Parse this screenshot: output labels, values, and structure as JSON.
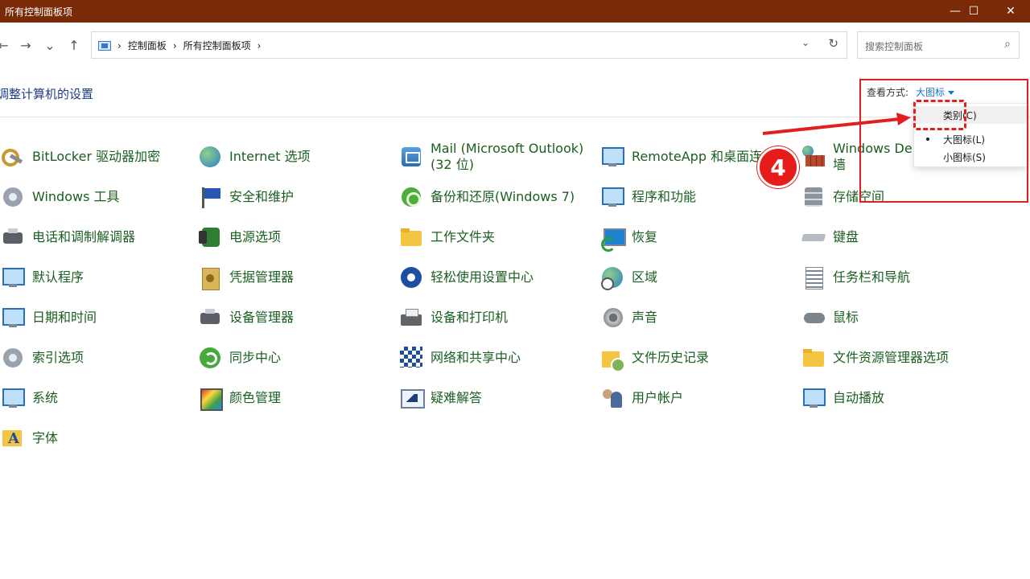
{
  "window": {
    "title": "所有控制面板项",
    "minimize": "—",
    "maximize": "☐",
    "close": "✕"
  },
  "nav": {
    "back": "←",
    "forward": "→",
    "recent": "⌄",
    "up": "↑",
    "breadcrumb": [
      "控制面板",
      "所有控制面板项"
    ],
    "sep": "›",
    "dropdown": "⌄",
    "refresh": "↻",
    "search_placeholder": "搜索控制面板",
    "search_icon": "⌕"
  },
  "header": {
    "title": "调整计算机的设置",
    "view_by_label": "查看方式:",
    "view_by_value": "大图标"
  },
  "items": [
    {
      "lines": [
        "BitLocker 驱动器加密"
      ],
      "icon": "key"
    },
    {
      "lines": [
        "Internet 选项"
      ],
      "icon": "globe"
    },
    {
      "lines": [
        "Mail (Microsoft Outlook)",
        "(32 位)"
      ],
      "icon": "mail"
    },
    {
      "lines": [
        "RemoteApp 和桌面连"
      ],
      "icon": "blue"
    },
    {
      "lines": [
        "Windows De",
        "墙"
      ],
      "icon": "firewall"
    },
    {
      "lines": [
        "Windows 工具"
      ],
      "icon": "gray"
    },
    {
      "lines": [
        "安全和维护"
      ],
      "icon": "flag"
    },
    {
      "lines": [
        "备份和还原(Windows 7)"
      ],
      "icon": "green"
    },
    {
      "lines": [
        "程序和功能"
      ],
      "icon": "blue"
    },
    {
      "lines": [
        "存储空间"
      ],
      "icon": "storage"
    },
    {
      "lines": [
        "电话和调制解调器"
      ],
      "icon": "dark"
    },
    {
      "lines": [
        "电源选项"
      ],
      "icon": "power"
    },
    {
      "lines": [
        "工作文件夹"
      ],
      "icon": "folder"
    },
    {
      "lines": [
        "恢复"
      ],
      "icon": "restore"
    },
    {
      "lines": [
        "键盘"
      ],
      "icon": "keyboard"
    },
    {
      "lines": [
        "默认程序"
      ],
      "icon": "blue"
    },
    {
      "lines": [
        "凭据管理器"
      ],
      "icon": "cred"
    },
    {
      "lines": [
        "轻松使用设置中心"
      ],
      "icon": "access"
    },
    {
      "lines": [
        "区域"
      ],
      "icon": "region"
    },
    {
      "lines": [
        "任务栏和导航"
      ],
      "icon": "taskbar"
    },
    {
      "lines": [
        "日期和时间"
      ],
      "icon": "blue"
    },
    {
      "lines": [
        "设备管理器"
      ],
      "icon": "dark"
    },
    {
      "lines": [
        "设备和打印机"
      ],
      "icon": "print"
    },
    {
      "lines": [
        "声音"
      ],
      "icon": "speaker"
    },
    {
      "lines": [
        "鼠标"
      ],
      "icon": "mouse"
    },
    {
      "lines": [
        "索引选项"
      ],
      "icon": "gray"
    },
    {
      "lines": [
        "同步中心"
      ],
      "icon": "sync"
    },
    {
      "lines": [
        "网络和共享中心"
      ],
      "icon": "network"
    },
    {
      "lines": [
        "文件历史记录"
      ],
      "icon": "history"
    },
    {
      "lines": [
        "文件资源管理器选项"
      ],
      "icon": "folder"
    },
    {
      "lines": [
        "系统"
      ],
      "icon": "blue"
    },
    {
      "lines": [
        "颜色管理"
      ],
      "icon": "color"
    },
    {
      "lines": [
        "疑难解答"
      ],
      "icon": "trouble"
    },
    {
      "lines": [
        "用户帐户"
      ],
      "icon": "users"
    },
    {
      "lines": [
        "自动播放"
      ],
      "icon": "blue"
    },
    {
      "lines": [
        "字体"
      ],
      "icon": "fonts"
    }
  ],
  "view_menu": {
    "options": [
      {
        "label": "类别(C)",
        "selected": false
      },
      {
        "label": "大图标(L)",
        "selected": true
      },
      {
        "label": "小图标(S)",
        "selected": false
      }
    ]
  },
  "annotation": {
    "step": "4",
    "color": "#e02020"
  }
}
